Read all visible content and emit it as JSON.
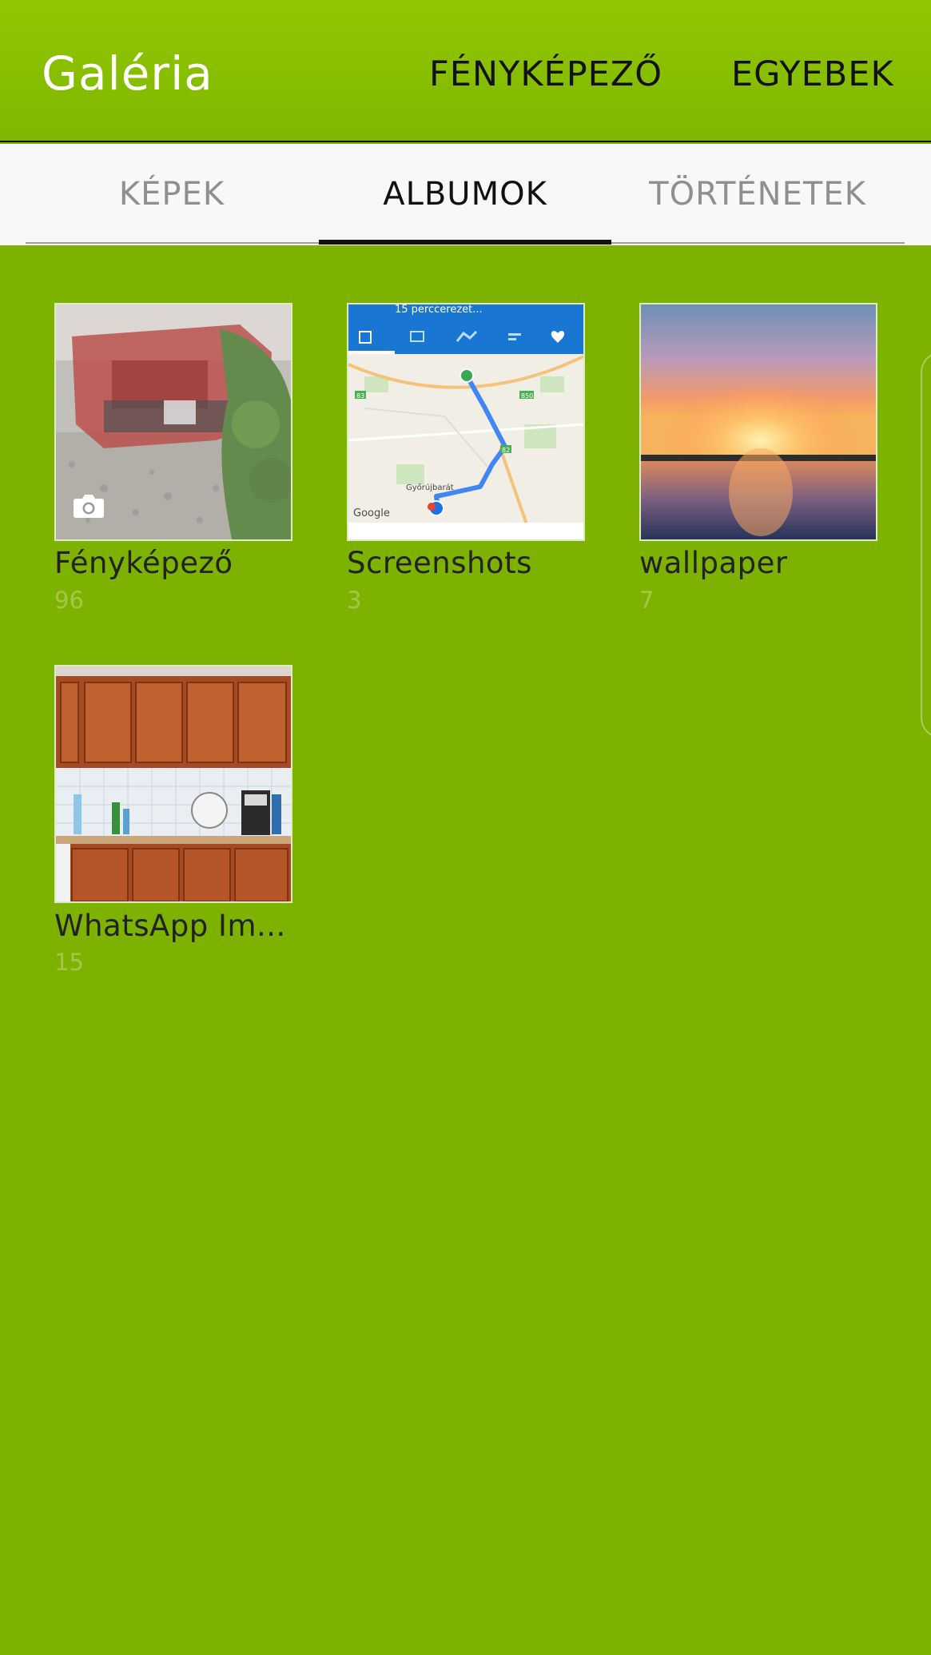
{
  "header": {
    "title": "Galéria",
    "camera_label": "FÉNYKÉPEZŐ",
    "more_label": "EGYEBEK"
  },
  "tabs": [
    {
      "label": "KÉPEK",
      "active": false
    },
    {
      "label": "ALBUMOK",
      "active": true
    },
    {
      "label": "TÖRTÉNETEK",
      "active": false
    }
  ],
  "albums": [
    {
      "name": "Fényképező",
      "count": "96",
      "thumbnail": "wrecked-red-car-photo",
      "badge_icon": "camera-icon"
    },
    {
      "name": "Screenshots",
      "count": "3",
      "thumbnail": "map-route-screenshot"
    },
    {
      "name": "wallpaper",
      "count": "7",
      "thumbnail": "sunset-over-lake"
    },
    {
      "name": "WhatsApp Im...",
      "count": "15",
      "thumbnail": "kitchen-cabinets-photo"
    }
  ],
  "map_thumbnail": {
    "header_text": "15 perccerezet...",
    "road_labels": [
      "83",
      "850",
      "82"
    ],
    "town_label": "Győrújbarát",
    "brand": "Google"
  },
  "colors": {
    "background": "#7db300",
    "header": "#8bc000",
    "tabbar": "#f8f8f8",
    "active_tab": "#111111",
    "inactive_tab": "#8f8f8f",
    "count_text": "#a6c64b"
  }
}
